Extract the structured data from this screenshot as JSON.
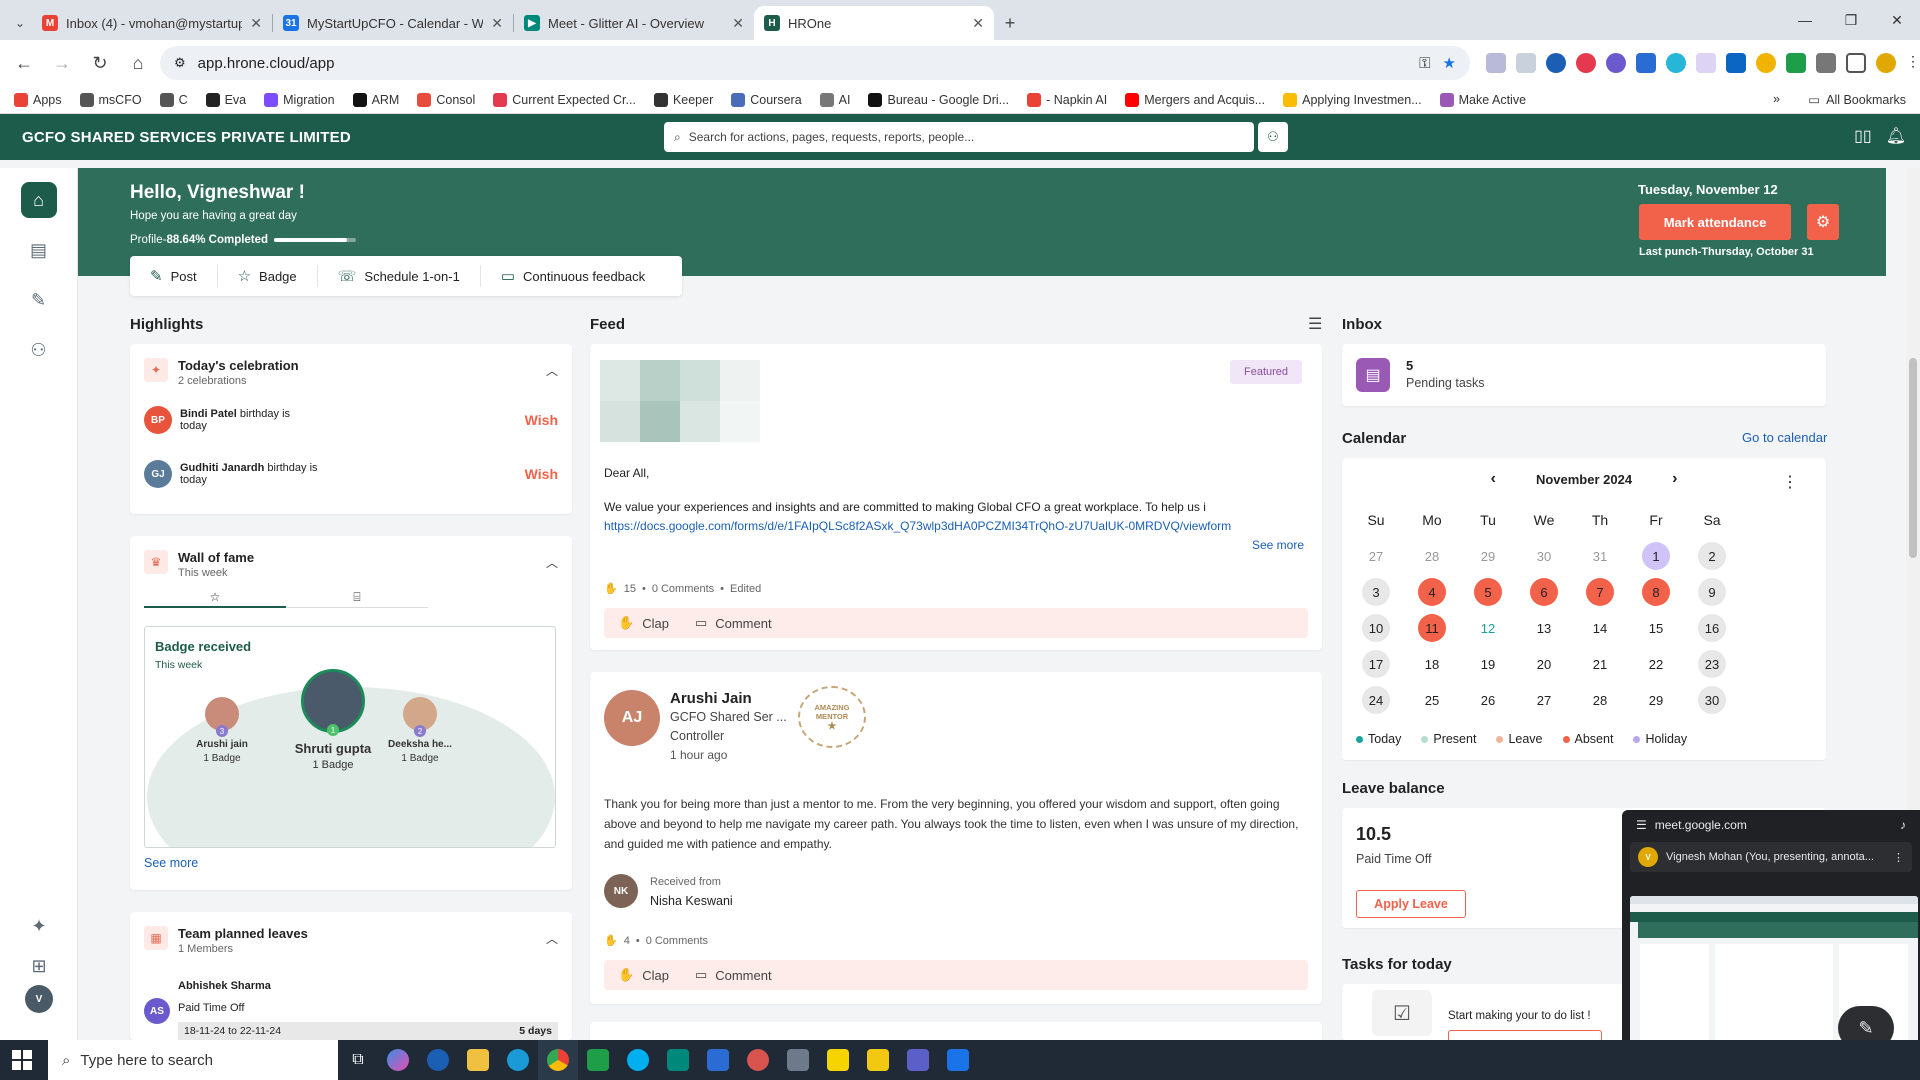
{
  "browser": {
    "tabs": [
      {
        "title": "Inbox (4) - vmohan@mystartup",
        "fav_color": "#ea4335",
        "fav_text": "M"
      },
      {
        "title": "MyStartUpCFO - Calendar - We",
        "fav_color": "#1a73e8",
        "fav_text": "31"
      },
      {
        "title": "Meet - Glitter AI - Overview",
        "fav_color": "#00897b",
        "fav_text": "▶"
      },
      {
        "title": "HROne",
        "fav_color": "#1d5b4a",
        "fav_text": "H"
      }
    ],
    "url": "app.hrone.cloud/app",
    "bookmarks": [
      "Apps",
      "msCFO",
      "C",
      "Eva",
      "Migration",
      "ARM",
      "Consol",
      "Current Expected Cr...",
      "Keeper",
      "Coursera",
      "AI",
      "Bureau - Google Dri...",
      "- Napkin AI",
      "Mergers and Acquis...",
      "Applying Investmen...",
      "Make Active"
    ],
    "all_bookmarks": "All Bookmarks"
  },
  "app": {
    "company": "GCFO SHARED SERVICES PRIVATE LIMITED",
    "search_placeholder": "Search for actions, pages, requests, reports, people..."
  },
  "banner": {
    "hello": "Hello, Vigneshwar !",
    "sub": "Hope you are having a great day",
    "profile_label": "Profile-",
    "profile_pct_text": "88.64% Completed",
    "profile_pct": 0.8864,
    "date": "Tuesday, November 12",
    "mark_attendance": "Mark attendance",
    "last_punch": "Last punch-Thursday, October 31"
  },
  "actions": [
    {
      "label": "Post",
      "icon": "✎",
      "name": "post-button"
    },
    {
      "label": "Badge",
      "icon": "☆",
      "name": "badge-button"
    },
    {
      "label": "Schedule 1-on-1",
      "icon": "☏",
      "name": "schedule-button"
    },
    {
      "label": "Continuous feedback",
      "icon": "▭",
      "name": "feedback-button"
    }
  ],
  "highlights": {
    "title": "Highlights",
    "celebration": {
      "title": "Today's celebration",
      "count": "2 celebrations",
      "items": [
        {
          "initials": "BP",
          "name": "Bindi Patel",
          "text": "birthday is",
          "when": "today",
          "wish": "Wish",
          "color": "#e8533b"
        },
        {
          "initials": "GJ",
          "name": "Gudhiti Janardh",
          "text": "birthday is",
          "when": "today",
          "wish": "Wish",
          "color": "#5a7b9a"
        }
      ]
    },
    "fame": {
      "title": "Wall of fame",
      "sub": "This week",
      "badge_title": "Badge received",
      "badge_sub": "This week",
      "people": [
        {
          "name": "Arushi jain",
          "count": "1 Badge",
          "rank": "3"
        },
        {
          "name": "Shruti gupta",
          "count": "1 Badge",
          "rank": "1"
        },
        {
          "name": "Deeksha he...",
          "count": "1 Badge",
          "rank": "2"
        }
      ],
      "see_more": "See more"
    },
    "leaves": {
      "title": "Team planned leaves",
      "sub": "1 Members",
      "person": "Abhishek Sharma",
      "initials": "AS",
      "type": "Paid Time Off",
      "range": "18-11-24 to 22-11-24",
      "days": "5 days"
    }
  },
  "feed": {
    "title": "Feed",
    "post1": {
      "featured": "Featured",
      "greeting": "Dear All,",
      "body": "We value your experiences and insights and are committed to making Global CFO a great workplace. To help us i",
      "link": "https://docs.google.com/forms/d/e/1FAIpQLSc8f2ASxk_Q73wlp3dHA0PCZMI34TrQhO-zU7UalUK-0MRDVQ/viewform",
      "see_more": "See more",
      "claps": "15",
      "comments": "0 Comments",
      "edited": "Edited",
      "clap": "Clap",
      "comment": "Comment"
    },
    "post2": {
      "name": "Arushi Jain",
      "org": "GCFO Shared Ser ...",
      "role": "Controller",
      "time": "1 hour ago",
      "badge_line1": "AMAZING",
      "badge_line2": "MENTOR",
      "body": "Thank you for being more than just a mentor to me. From the very beginning, you offered your wisdom and support, often going above and beyond to help me navigate my career path. You always took the time to listen, even when I was unsure of my direction, and guided me with patience and empathy.",
      "received_from": "Received from",
      "from_name": "Nisha Keswani",
      "claps": "4",
      "comments": "0 Comments",
      "clap": "Clap",
      "comment": "Comment"
    }
  },
  "inbox": {
    "title": "Inbox",
    "count": "5",
    "label": "Pending tasks"
  },
  "calendar": {
    "title": "Calendar",
    "go": "Go to calendar",
    "month": "November 2024",
    "days": [
      "Su",
      "Mo",
      "Tu",
      "We",
      "Th",
      "Fr",
      "Sa"
    ],
    "weeks": [
      [
        {
          "d": "27",
          "k": "muted"
        },
        {
          "d": "28",
          "k": "muted"
        },
        {
          "d": "29",
          "k": "muted"
        },
        {
          "d": "30",
          "k": "muted"
        },
        {
          "d": "31",
          "k": "muted"
        },
        {
          "d": "1",
          "k": "holiday"
        },
        {
          "d": "2",
          "k": "weekend"
        }
      ],
      [
        {
          "d": "3",
          "k": "weekend"
        },
        {
          "d": "4",
          "k": "absent"
        },
        {
          "d": "5",
          "k": "absent"
        },
        {
          "d": "6",
          "k": "absent"
        },
        {
          "d": "7",
          "k": "absent"
        },
        {
          "d": "8",
          "k": "absent"
        },
        {
          "d": "9",
          "k": "weekend"
        }
      ],
      [
        {
          "d": "10",
          "k": "weekend"
        },
        {
          "d": "11",
          "k": "absent"
        },
        {
          "d": "12",
          "k": "today"
        },
        {
          "d": "13",
          "k": ""
        },
        {
          "d": "14",
          "k": ""
        },
        {
          "d": "15",
          "k": ""
        },
        {
          "d": "16",
          "k": "weekend"
        }
      ],
      [
        {
          "d": "17",
          "k": "weekend"
        },
        {
          "d": "18",
          "k": ""
        },
        {
          "d": "19",
          "k": ""
        },
        {
          "d": "20",
          "k": ""
        },
        {
          "d": "21",
          "k": ""
        },
        {
          "d": "22",
          "k": ""
        },
        {
          "d": "23",
          "k": "weekend"
        }
      ],
      [
        {
          "d": "24",
          "k": "weekend"
        },
        {
          "d": "25",
          "k": ""
        },
        {
          "d": "26",
          "k": ""
        },
        {
          "d": "27",
          "k": ""
        },
        {
          "d": "28",
          "k": ""
        },
        {
          "d": "29",
          "k": ""
        },
        {
          "d": "30",
          "k": "weekend"
        }
      ]
    ],
    "legend": [
      {
        "label": "Today",
        "color": "#1aa39b"
      },
      {
        "label": "Present",
        "color": "#b7dccf"
      },
      {
        "label": "Leave",
        "color": "#f0b49a"
      },
      {
        "label": "Absent",
        "color": "#f2624a"
      },
      {
        "label": "Holiday",
        "color": "#b9a7f0"
      }
    ]
  },
  "leave_balance": {
    "title": "Leave balance",
    "value": "10.5",
    "type": "Paid Time Off",
    "apply": "Apply Leave"
  },
  "tasks": {
    "title": "Tasks for today",
    "text": "Start making your to do list !"
  },
  "meet": {
    "host": "meet.google.com",
    "presenter": "Vignesh Mohan (You, presenting, annota..."
  },
  "taskbar": {
    "search": "Type here to search"
  },
  "colors": {
    "brand": "#1d5b4a",
    "banner": "#2e6e5b",
    "accent": "#f2624a"
  }
}
